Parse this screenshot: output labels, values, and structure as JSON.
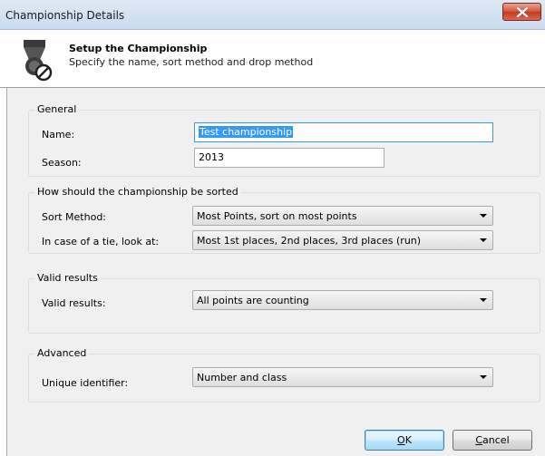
{
  "window": {
    "title": "Championship Details"
  },
  "header": {
    "title": "Setup the Championship",
    "subtitle": "Specify the name, sort method and drop method"
  },
  "general": {
    "group_label": "General",
    "name_label": "Name:",
    "name_value": "Test championship",
    "season_label": "Season:",
    "season_value": "2013"
  },
  "sorting": {
    "group_label": "How should the championship be sorted",
    "sort_label": "Sort Method:",
    "sort_value": "Most Points, sort on most points",
    "tie_label": "In case of a tie, look at:",
    "tie_value": "Most 1st places, 2nd places, 3rd places (run)"
  },
  "valid": {
    "group_label": "Valid results",
    "label": "Valid results:",
    "value": "All points are counting"
  },
  "advanced": {
    "group_label": "Advanced",
    "label": "Unique identifier:",
    "value": "Number and class"
  },
  "buttons": {
    "ok_mnemonic": "O",
    "ok_rest": "K",
    "cancel_mnemonic": "C",
    "cancel_rest": "ancel"
  },
  "icons": {
    "close": "close-icon",
    "header": "medal-icon"
  }
}
